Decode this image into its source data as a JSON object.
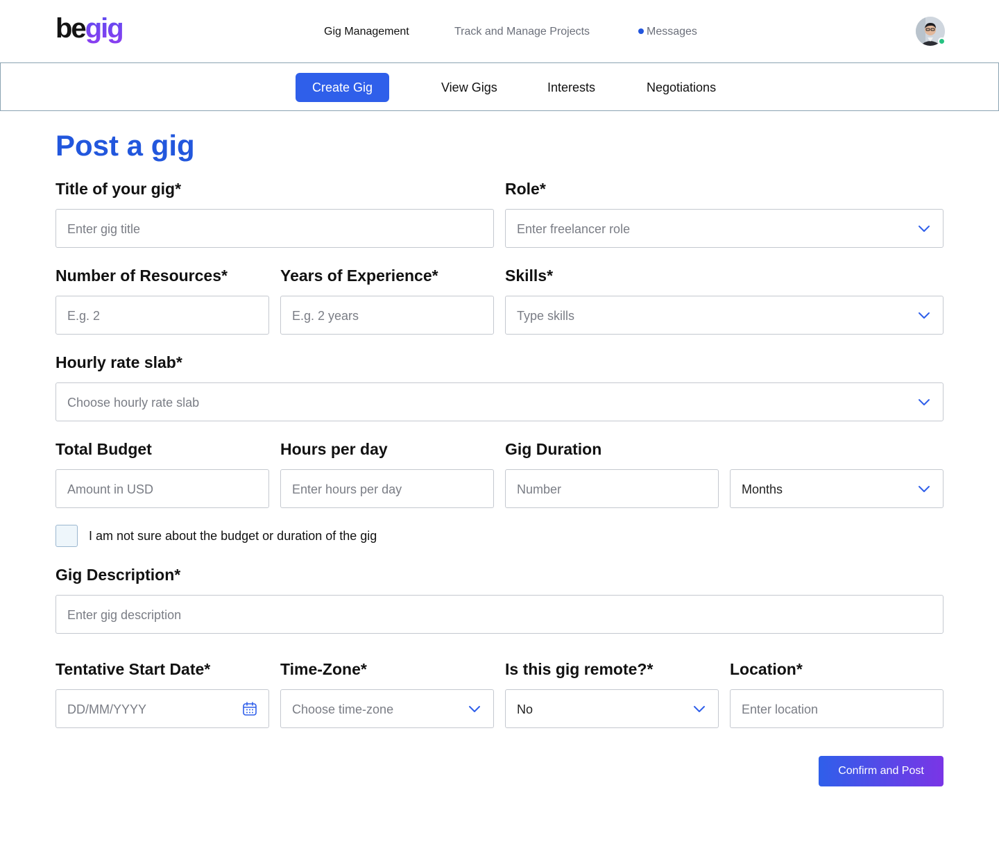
{
  "brand": {
    "logo_part1": "be",
    "logo_part2": "gig"
  },
  "top_nav": {
    "gig_management": "Gig Management",
    "track_projects": "Track and Manage Projects",
    "messages": "Messages"
  },
  "sub_nav": {
    "tabs": [
      {
        "label": "Create Gig",
        "active": true
      },
      {
        "label": "View Gigs",
        "active": false
      },
      {
        "label": "Interests",
        "active": false
      },
      {
        "label": "Negotiations",
        "active": false
      }
    ]
  },
  "form": {
    "page_title": "Post a gig",
    "title": {
      "label": "Title of your gig*",
      "placeholder": "Enter gig title"
    },
    "role": {
      "label": "Role*",
      "placeholder": "Enter freelancer role"
    },
    "resources": {
      "label": "Number of Resources*",
      "placeholder": "E.g. 2"
    },
    "experience": {
      "label": "Years of Experience*",
      "placeholder": "E.g. 2 years"
    },
    "skills": {
      "label": "Skills*",
      "placeholder": "Type skills"
    },
    "hourly_rate": {
      "label": "Hourly rate slab*",
      "placeholder": "Choose hourly rate slab"
    },
    "budget": {
      "label": "Total Budget",
      "placeholder": "Amount in USD"
    },
    "hours": {
      "label": "Hours per day",
      "placeholder": "Enter hours per day"
    },
    "duration": {
      "label": "Gig Duration",
      "number_placeholder": "Number",
      "unit_value": "Months"
    },
    "unsure_checkbox": {
      "label": "I am not sure about the budget or duration of the gig",
      "checked": false
    },
    "description": {
      "label": "Gig Description*",
      "placeholder": "Enter gig description"
    },
    "start_date": {
      "label": "Tentative Start Date*",
      "placeholder": "DD/MM/YYYY"
    },
    "timezone": {
      "label": "Time-Zone*",
      "placeholder": "Choose time-zone"
    },
    "remote": {
      "label": "Is this gig remote?*",
      "value": "No"
    },
    "location": {
      "label": "Location*",
      "placeholder": "Enter location"
    },
    "confirm_label": "Confirm and Post"
  },
  "colors": {
    "accent": "#2f5fea",
    "title_blue": "#2257dd",
    "gradient_end": "#7a35e6",
    "status_online": "#26c281"
  },
  "icons": [
    "chevron-down-icon",
    "calendar-icon",
    "user-avatar"
  ]
}
